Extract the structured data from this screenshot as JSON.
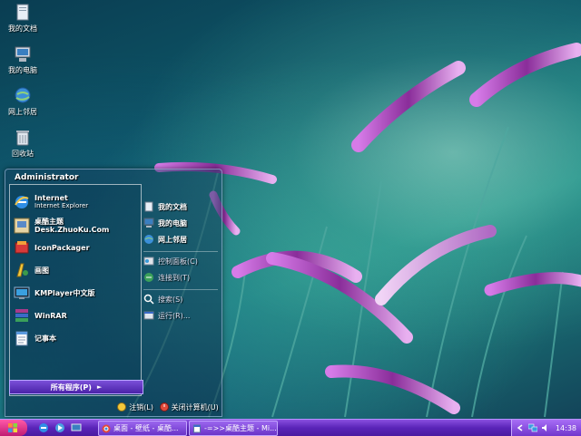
{
  "desktop": {
    "icons": [
      {
        "label": "我的文档",
        "icon": "my-documents-icon"
      },
      {
        "label": "我的电脑",
        "icon": "my-computer-icon"
      },
      {
        "label": "网上邻居",
        "icon": "network-places-icon"
      },
      {
        "label": "回收站",
        "icon": "recycle-bin-icon"
      }
    ]
  },
  "start_menu": {
    "user": "Administrator",
    "programs": [
      {
        "label": "Internet",
        "sublabel": "Internet Explorer",
        "icon": "ie-icon"
      },
      {
        "label": "桌酷主题Desk.ZhuoKu.Com",
        "icon": "zhuoku-icon"
      },
      {
        "label": "IconPackager",
        "icon": "iconpackager-icon"
      },
      {
        "label": "画图",
        "icon": "paint-icon"
      },
      {
        "label": "KMPlayer中文版",
        "icon": "kmplayer-icon"
      },
      {
        "label": "WinRAR",
        "icon": "winrar-icon"
      },
      {
        "label": "记事本",
        "icon": "notepad-icon"
      }
    ],
    "all_programs": "所有程序(P)",
    "places": [
      {
        "label": "我的文档",
        "icon": "my-documents-icon"
      },
      {
        "label": "我的电脑",
        "icon": "my-computer-icon"
      },
      {
        "label": "网上邻居",
        "icon": "network-places-icon"
      }
    ],
    "settings": [
      {
        "label": "控制面板(C)",
        "icon": "control-panel-icon"
      },
      {
        "label": "连接到(T)",
        "icon": "connect-to-icon"
      }
    ],
    "tools": [
      {
        "label": "搜索(S)",
        "icon": "search-icon"
      },
      {
        "label": "运行(R)...",
        "icon": "run-icon"
      }
    ],
    "logoff": "注销(L)",
    "shutdown": "关闭计算机(U)"
  },
  "taskbar": {
    "windows": [
      {
        "label": "桌面 - 壁纸 - 桌酷...",
        "icon": "chrome-icon"
      },
      {
        "label": "-=>>桌酷主题 - Mi...",
        "icon": "document-icon"
      }
    ],
    "clock": "14:38"
  },
  "colors": {
    "taskbar": "#5a24b8",
    "start_button": "#e0308a",
    "all_programs": "#6a3ac8"
  }
}
